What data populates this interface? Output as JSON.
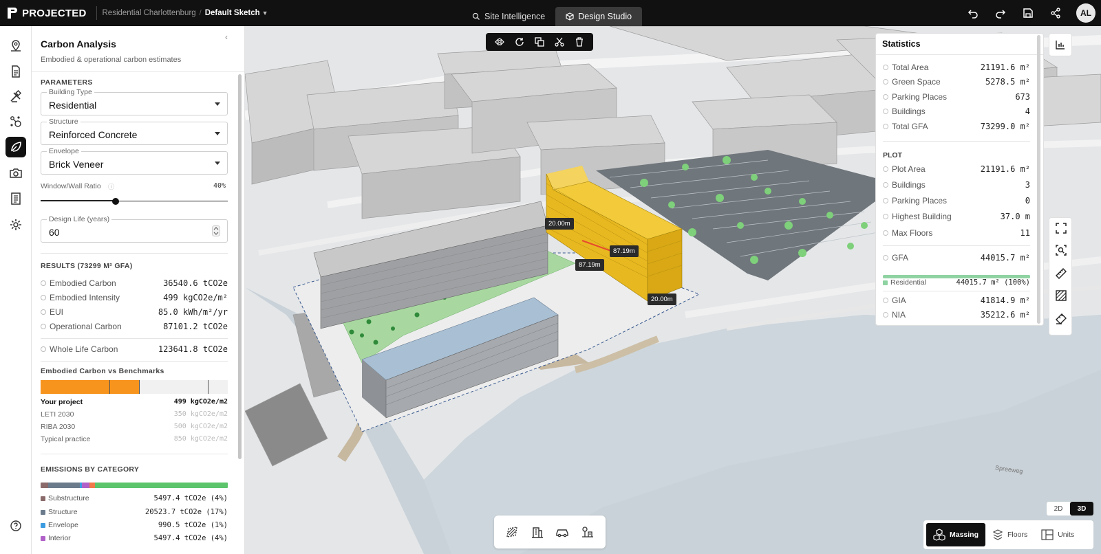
{
  "app": {
    "name": "PROJECTED"
  },
  "breadcrumb": {
    "project": "Residential Charlottenburg",
    "separator": "/",
    "sketch": "Default Sketch"
  },
  "topnav": {
    "tabs": [
      {
        "label": "Site Intelligence",
        "active": false
      },
      {
        "label": "Design Studio",
        "active": true
      }
    ]
  },
  "user": {
    "initials": "AL"
  },
  "panel": {
    "title": "Carbon Analysis",
    "subtitle": "Embodied & operational carbon estimates",
    "parameters_head": "PARAMETERS",
    "building_type": {
      "label": "Building Type",
      "value": "Residential"
    },
    "structure": {
      "label": "Structure",
      "value": "Reinforced Concrete"
    },
    "envelope": {
      "label": "Envelope",
      "value": "Brick Veneer"
    },
    "wwr": {
      "label": "Window/Wall Ratio",
      "value": "40%",
      "fraction": 0.4
    },
    "design_life": {
      "label": "Design Life (years)",
      "value": "60"
    },
    "results_head": "RESULTS (73299 M² GFA)",
    "results": [
      {
        "label": "Embodied Carbon",
        "value": "36540.6 tCO2e"
      },
      {
        "label": "Embodied Intensity",
        "value": "499 kgCO2e/m²"
      },
      {
        "label": "EUI",
        "value": "85.0 kWh/m²/yr"
      },
      {
        "label": "Operational Carbon",
        "value": "87101.2 tCO2e"
      }
    ],
    "whole_life": {
      "label": "Whole Life Carbon",
      "value": "123641.8 tCO2e"
    },
    "benchmarks_head": "Embodied Carbon vs Benchmarks",
    "benchmark_scale_max": 950,
    "benchmark_fill_color": "#f7941d",
    "benchmarks": [
      {
        "label": "Your project",
        "value": "499 kgCO2e/m2",
        "number": 499,
        "is_project": true
      },
      {
        "label": "LETI 2030",
        "value": "350 kgCO2e/m2",
        "number": 350
      },
      {
        "label": "RIBA 2030",
        "value": "500 kgCO2e/m2",
        "number": 500
      },
      {
        "label": "Typical practice",
        "value": "850 kgCO2e/m2",
        "number": 850
      }
    ],
    "emissions_head": "EMISSIONS BY CATEGORY",
    "categories": [
      {
        "label": "Substructure",
        "value": "5497.4 tCO2e (4%)",
        "share": 0.04,
        "color": "#8a6a6a"
      },
      {
        "label": "Structure",
        "value": "20523.7 tCO2e (17%)",
        "share": 0.17,
        "color": "#6b7b8c"
      },
      {
        "label": "Envelope",
        "value": "990.5 tCO2e (1%)",
        "share": 0.01,
        "color": "#3b9be0"
      },
      {
        "label": "Interior",
        "value": "5497.4 tCO2e (4%)",
        "share": 0.04,
        "color": "#b060c8"
      }
    ],
    "category_bar_rest": [
      {
        "share": 0.03,
        "color": "#f07a4a"
      },
      {
        "share": 0.71,
        "color": "#5cc46a"
      }
    ]
  },
  "map": {
    "dimensions": [
      "20.00m",
      "87.19m",
      "87.19m",
      "20.00m"
    ],
    "street_name": "Spreeweg"
  },
  "stats": {
    "title": "Statistics",
    "summary": [
      {
        "label": "Total Area",
        "value": "21191.6 m²"
      },
      {
        "label": "Green Space",
        "value": "5278.5 m²"
      },
      {
        "label": "Parking Places",
        "value": "673"
      },
      {
        "label": "Buildings",
        "value": "4"
      },
      {
        "label": "Total GFA",
        "value": "73299.0 m²"
      }
    ],
    "plot_head": "PLOT",
    "plot": [
      {
        "label": "Plot Area",
        "value": "21191.6 m²"
      },
      {
        "label": "Buildings",
        "value": "3"
      },
      {
        "label": "Parking Places",
        "value": "0"
      },
      {
        "label": "Highest Building",
        "value": "37.0 m"
      },
      {
        "label": "Max Floors",
        "value": "11"
      }
    ],
    "gfa": {
      "label": "GFA",
      "value": "44015.7 m²"
    },
    "gfa_split": {
      "label": "Residential",
      "value": "44015.7 m² (100%)",
      "color": "#8fd3a2"
    },
    "more": [
      {
        "label": "GIA",
        "value": "41814.9 m²"
      },
      {
        "label": "NIA",
        "value": "35212.6 m²"
      }
    ]
  },
  "view_toggle": {
    "options": [
      {
        "label": "2D",
        "active": false
      },
      {
        "label": "3D",
        "active": true
      }
    ]
  },
  "modes": [
    {
      "label": "Massing",
      "active": true
    },
    {
      "label": "Floors",
      "active": false
    },
    {
      "label": "Units",
      "active": false
    }
  ]
}
